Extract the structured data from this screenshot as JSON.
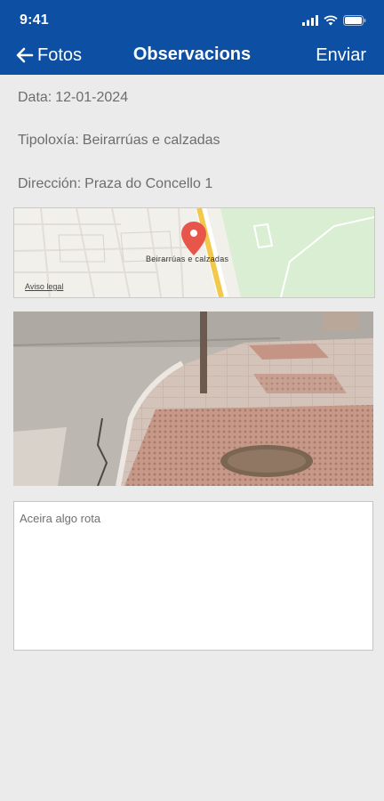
{
  "status_bar": {
    "time": "9:41"
  },
  "header": {
    "back_label": "Fotos",
    "title": "Observacions",
    "action_label": "Enviar",
    "color": "#0d4fa3"
  },
  "form": {
    "date": {
      "label": "Data:",
      "value": "12-01-2024"
    },
    "type": {
      "label": "Tipoloxía:",
      "value": "Beirarrúas e calzadas"
    },
    "address": {
      "label": "Dirección:",
      "value": "Praza do Concello 1"
    }
  },
  "map": {
    "marker_label": "Beirarrúas e calzadas",
    "legal_link": "Aviso legal",
    "marker_icon": "map-pin-icon",
    "marker_color": "#e8554a"
  },
  "photo": {
    "description_icon": "photo"
  },
  "observations": {
    "value": "Aceira algo rota"
  }
}
